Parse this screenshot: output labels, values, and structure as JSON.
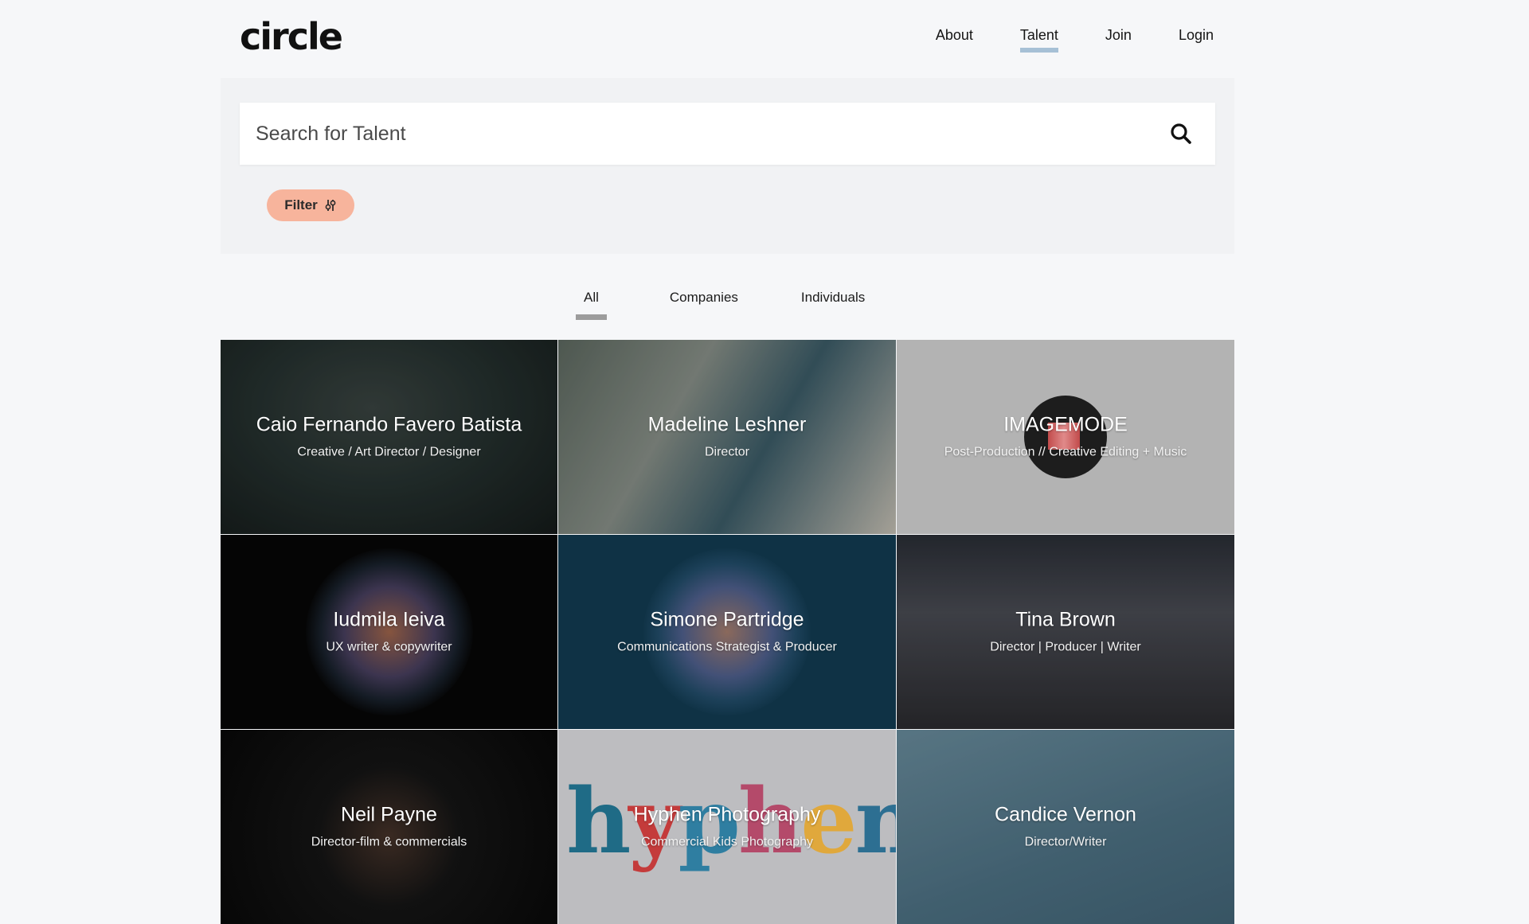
{
  "header": {
    "logo": "circle",
    "nav": [
      {
        "label": "About",
        "active": false
      },
      {
        "label": "Talent",
        "active": true
      },
      {
        "label": "Join",
        "active": false
      },
      {
        "label": "Login",
        "active": false
      }
    ]
  },
  "search": {
    "placeholder": "Search for Talent",
    "value": "",
    "icon": "search-icon"
  },
  "filter": {
    "label": "Filter",
    "icon": "sliders-icon"
  },
  "tabs": [
    {
      "label": "All",
      "active": true
    },
    {
      "label": "Companies",
      "active": false
    },
    {
      "label": "Individuals",
      "active": false
    }
  ],
  "cards": [
    {
      "name": "Caio Fernando Favero Batista",
      "role": "Creative / Art Director / Designer"
    },
    {
      "name": "Madeline Leshner",
      "role": "Director"
    },
    {
      "name": "IMAGEMODE",
      "role": "Post-Production // Creative Editing + Music"
    },
    {
      "name": "Iudmila Ieiva",
      "role": "UX writer & copywriter"
    },
    {
      "name": "Simone Partridge",
      "role": "Communications Strategist & Producer"
    },
    {
      "name": "Tina Brown",
      "role": "Director | Producer | Writer"
    },
    {
      "name": "Neil Payne",
      "role": "Director-film & commercials"
    },
    {
      "name": "Hyphen Photography",
      "role": "Commercial Kids Photography"
    },
    {
      "name": "Candice Vernon",
      "role": "Director/Writer"
    }
  ],
  "colors": {
    "accent_underline": "#a6c0d6",
    "filter_button": "#f7b49c",
    "tab_underline": "#9c9c9c",
    "page_bg": "#f6f7f9"
  }
}
